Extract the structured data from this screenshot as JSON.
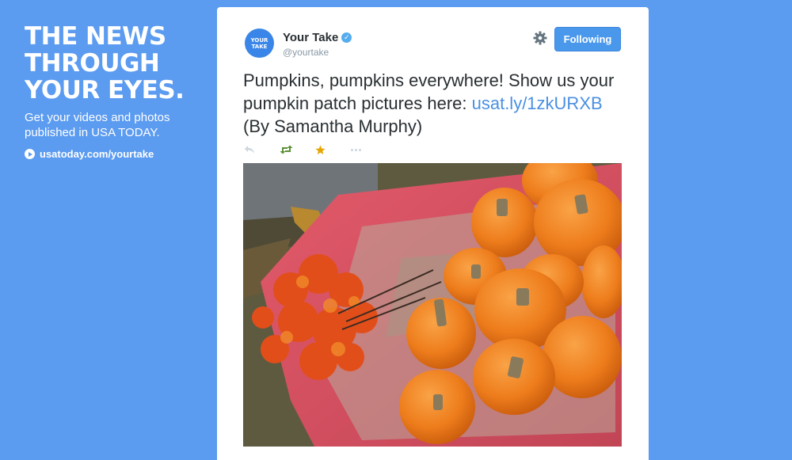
{
  "promo": {
    "headline": "THE NEWS\nTHROUGH\nYOUR EYES.",
    "subtext": "Get your videos and photos\npublished in USA TODAY.",
    "link_label": "usatoday.com/yourtake",
    "icon": "play-circle-icon"
  },
  "tweet": {
    "avatar_text": "YOUR\nTAKE",
    "author_name": "Your Take",
    "author_handle": "@yourtake",
    "verified_icon": "verified-badge-icon",
    "settings_icon": "gear-icon",
    "follow_label": "Following",
    "text_before_link": "Pumpkins, pumpkins everywhere! Show us your pumpkin patch pictures here: ",
    "link_text": "usat.ly/1zkURXB",
    "text_after_link": " (By Samantha Murphy)",
    "actions": [
      "reply-icon",
      "retweet-icon",
      "favorite-star-icon",
      "more-icon"
    ],
    "photo_icon": "pumpkins-in-wheelbarrow-photo"
  },
  "colors": {
    "background": "#5B9BF0",
    "card": "#FFFFFF",
    "follow_button": "#4A98EC",
    "link": "#4A90E2",
    "retweet_green": "#5C9137",
    "star_gold": "#E8A400"
  }
}
